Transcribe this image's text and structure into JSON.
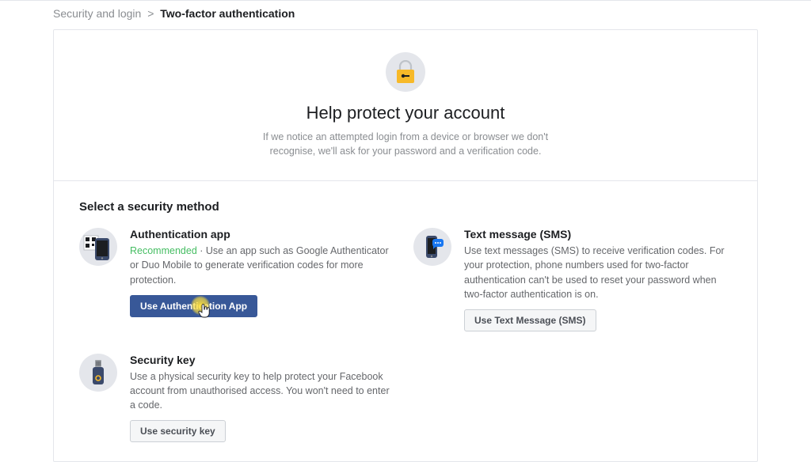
{
  "breadcrumb": {
    "parent": "Security and login",
    "separator": ">",
    "current": "Two-factor authentication"
  },
  "hero": {
    "title": "Help protect your account",
    "description": "If we notice an attempted login from a device or browser we don't recognise, we'll ask for your password and a verification code."
  },
  "section_title": "Select a security method",
  "methods": {
    "auth_app": {
      "title": "Authentication app",
      "recommended": "Recommended",
      "dot": "·",
      "desc": "Use an app such as Google Authenticator or Duo Mobile to generate verification codes for more protection.",
      "button": "Use Authentication App"
    },
    "sms": {
      "title": "Text message (SMS)",
      "desc": "Use text messages (SMS) to receive verification codes. For your protection, phone numbers used for two-factor authentication can't be used to reset your password when two-factor authentication is on.",
      "button": "Use Text Message (SMS)"
    },
    "security_key": {
      "title": "Security key",
      "desc": "Use a physical security key to help protect your Facebook account from unauthorised access. You won't need to enter a code.",
      "button": "Use security key"
    }
  }
}
